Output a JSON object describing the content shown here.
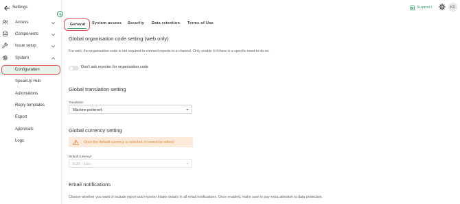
{
  "sidebar": {
    "header_title": "Settings",
    "groups": [
      {
        "label": "Access",
        "icon": "users-icon"
      },
      {
        "label": "Components",
        "icon": "database-icon"
      },
      {
        "label": "Issue setup",
        "icon": "wrench-icon"
      },
      {
        "label": "System",
        "icon": "gear-icon"
      }
    ],
    "items": [
      {
        "label": "Configuration",
        "active": true
      },
      {
        "label": "SpeakUp Hub"
      },
      {
        "label": "Automations"
      },
      {
        "label": "Reply templates"
      },
      {
        "label": "Export"
      },
      {
        "label": "Approvals"
      },
      {
        "label": "Logs"
      }
    ]
  },
  "topbar": {
    "support_label": "Support",
    "avatar_initials": "KD"
  },
  "tabs": [
    {
      "label": "General",
      "active": true
    },
    {
      "label": "System access"
    },
    {
      "label": "Security"
    },
    {
      "label": "Data retention"
    },
    {
      "label": "Terms of Use"
    }
  ],
  "sections": {
    "org_code": {
      "title": "Global organisation code setting (web only)",
      "description": "For web, the organisation code is not required to connect reports to a channel. Only enable it if there is a specific need to do so.",
      "toggle_label": "Don't ask reporter for organisation code",
      "toggle_on": false
    },
    "translation": {
      "title": "Global translation setting",
      "field_label": "Translation",
      "value": "Machine preferred"
    },
    "currency": {
      "title": "Global currency setting",
      "warning": "Once the default currency is selected, it cannot be edited.",
      "field_label": "Default currency*",
      "value": "EUR - Euro"
    },
    "email": {
      "title": "Email notifications",
      "description": "Choose whether you want to include report and reporter intake details in all email notifications. Once enabled, make sure to pay extra attention to data protection."
    }
  },
  "colors": {
    "accent": "#2e9d62",
    "highlight": "#e0484a",
    "warning_bg": "#fbe9d9",
    "warning_text": "#d9893d"
  }
}
